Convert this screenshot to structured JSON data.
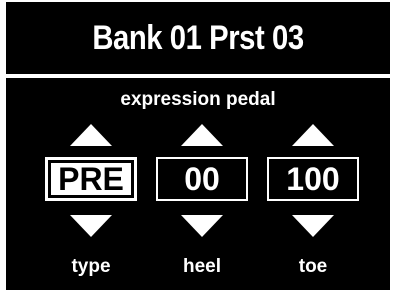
{
  "header": {
    "title": "Bank 01 Prst 03"
  },
  "section": {
    "title": "expression pedal"
  },
  "params": [
    {
      "label": "type",
      "value": "PRE",
      "selected": true
    },
    {
      "label": "heel",
      "value": "00",
      "selected": false
    },
    {
      "label": "toe",
      "value": "100",
      "selected": false
    }
  ],
  "colors": {
    "background": "#000000",
    "foreground": "#ffffff"
  }
}
